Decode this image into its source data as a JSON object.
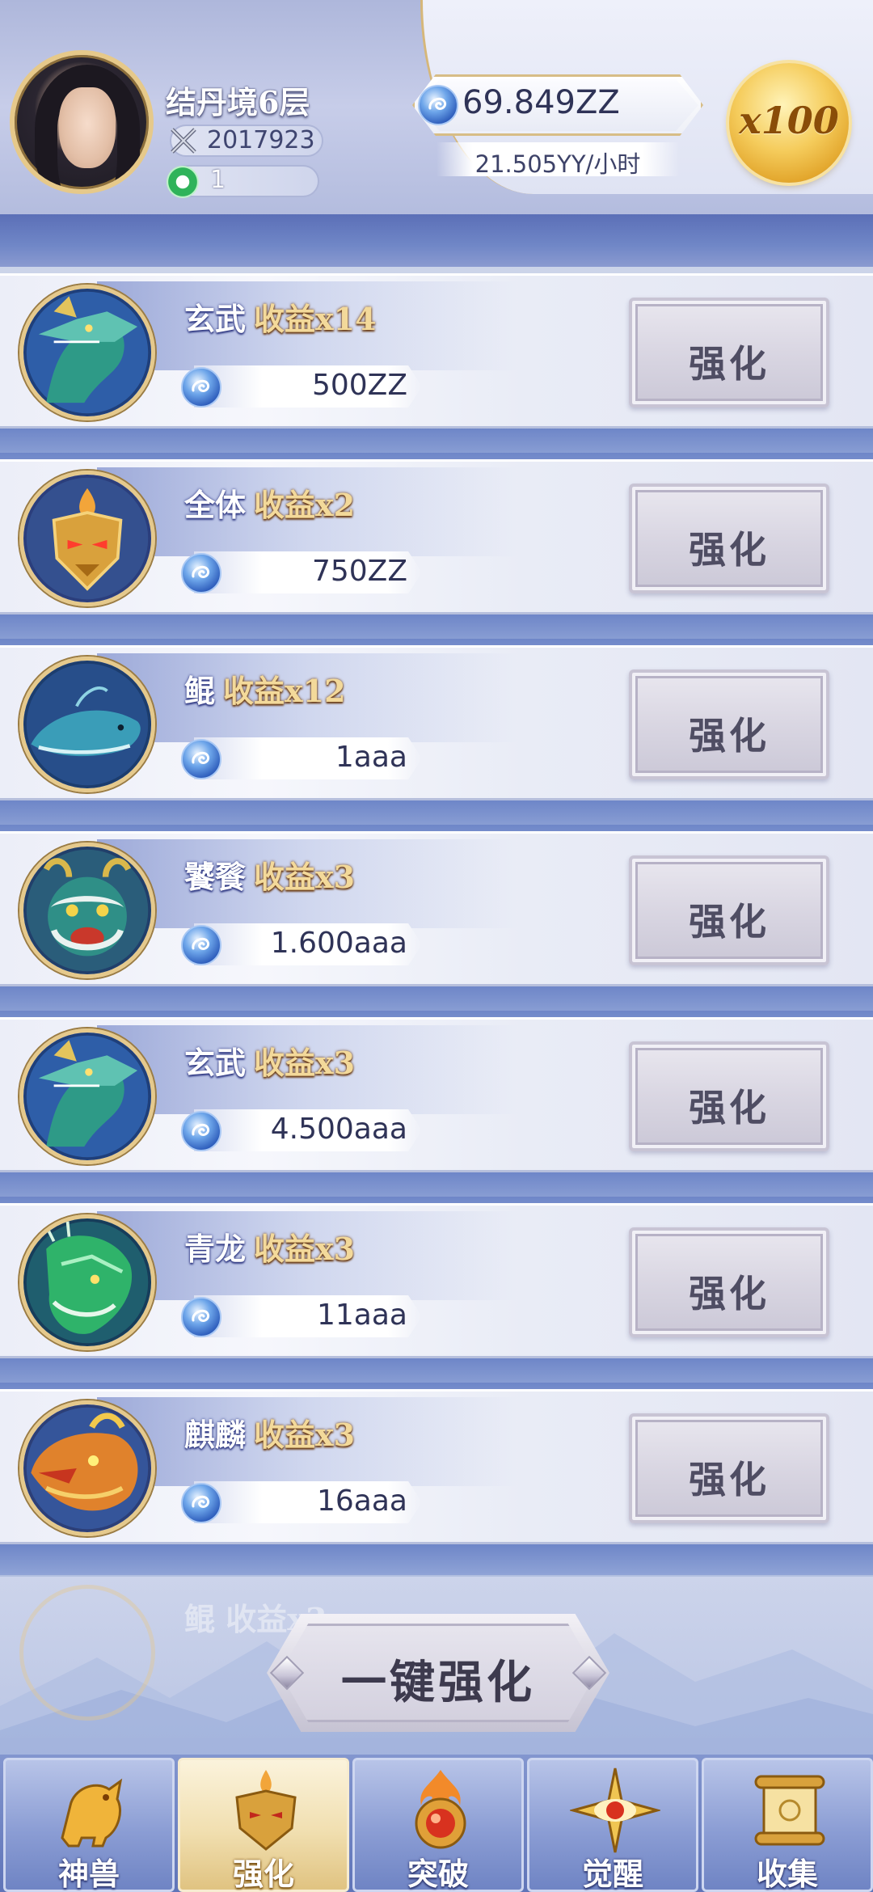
{
  "player": {
    "realm": "结丹境6层",
    "power": "2017923",
    "jade": "1"
  },
  "currency": {
    "value": "69.849ZZ",
    "rate": "21.505YY/小时",
    "multiplier": "x100"
  },
  "list": {
    "button_label": "强化",
    "items": [
      {
        "name": "玄武",
        "income": "收益x14",
        "cost": "500ZZ",
        "icon": "black-tortoise-dragon-icon"
      },
      {
        "name": "全体",
        "income": "收益x2",
        "cost": "750ZZ",
        "icon": "golden-mask-icon"
      },
      {
        "name": "鲲",
        "income": "收益x12",
        "cost": "1aaa",
        "icon": "kun-whale-icon"
      },
      {
        "name": "饕餮",
        "income": "收益x3",
        "cost": "1.600aaa",
        "icon": "taotie-beast-icon"
      },
      {
        "name": "玄武",
        "income": "收益x3",
        "cost": "4.500aaa",
        "icon": "black-tortoise-dragon-icon"
      },
      {
        "name": "青龙",
        "income": "收益x3",
        "cost": "11aaa",
        "icon": "azure-dragon-icon"
      },
      {
        "name": "麒麟",
        "income": "收益x3",
        "cost": "16aaa",
        "icon": "qilin-icon"
      }
    ],
    "ghost_row_text": "鲲 收益x3"
  },
  "one_click": {
    "label": "一键强化"
  },
  "nav": {
    "tabs": [
      {
        "label": "神兽",
        "icon": "golden-qilin-icon",
        "active": false
      },
      {
        "label": "强化",
        "icon": "golden-mask-icon",
        "active": true
      },
      {
        "label": "突破",
        "icon": "flame-orb-icon",
        "active": false
      },
      {
        "label": "觉醒",
        "icon": "eye-star-icon",
        "active": false
      },
      {
        "label": "收集",
        "icon": "scroll-icon",
        "active": false
      }
    ]
  },
  "colors": {
    "accent_gold": "#e5c98c",
    "header_blue": "#5b6fb7",
    "active_tab": "#f1dfb0"
  }
}
